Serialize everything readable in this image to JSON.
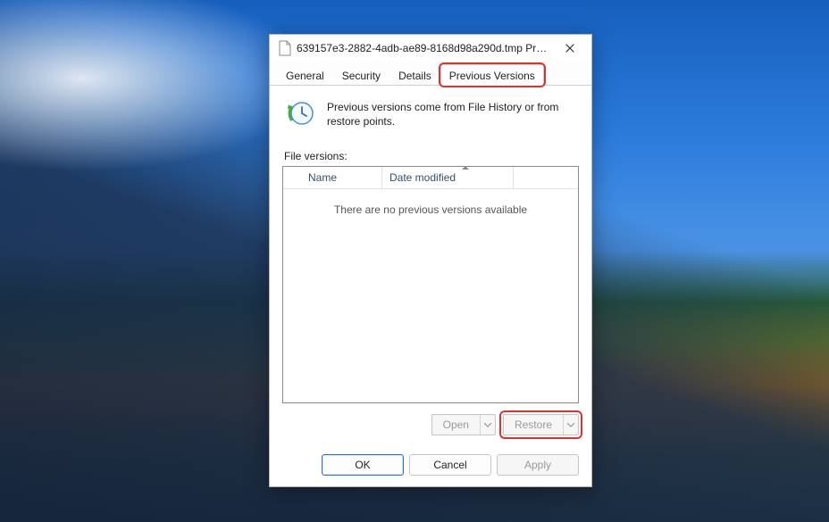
{
  "titlebar": {
    "title": "639157e3-2882-4adb-ae89-8168d98a290d.tmp Proper…"
  },
  "tabs": {
    "general": "General",
    "security": "Security",
    "details": "Details",
    "previous_versions": "Previous Versions"
  },
  "info": {
    "text": "Previous versions come from File History or from restore points."
  },
  "versions": {
    "section_label": "File versions:",
    "columns": {
      "name": "Name",
      "date_modified": "Date modified"
    },
    "rows": [],
    "empty_message": "There are no previous versions available"
  },
  "actions": {
    "open": "Open",
    "restore": "Restore"
  },
  "footer": {
    "ok": "OK",
    "cancel": "Cancel",
    "apply": "Apply"
  },
  "colors": {
    "highlight": "#e03030"
  }
}
